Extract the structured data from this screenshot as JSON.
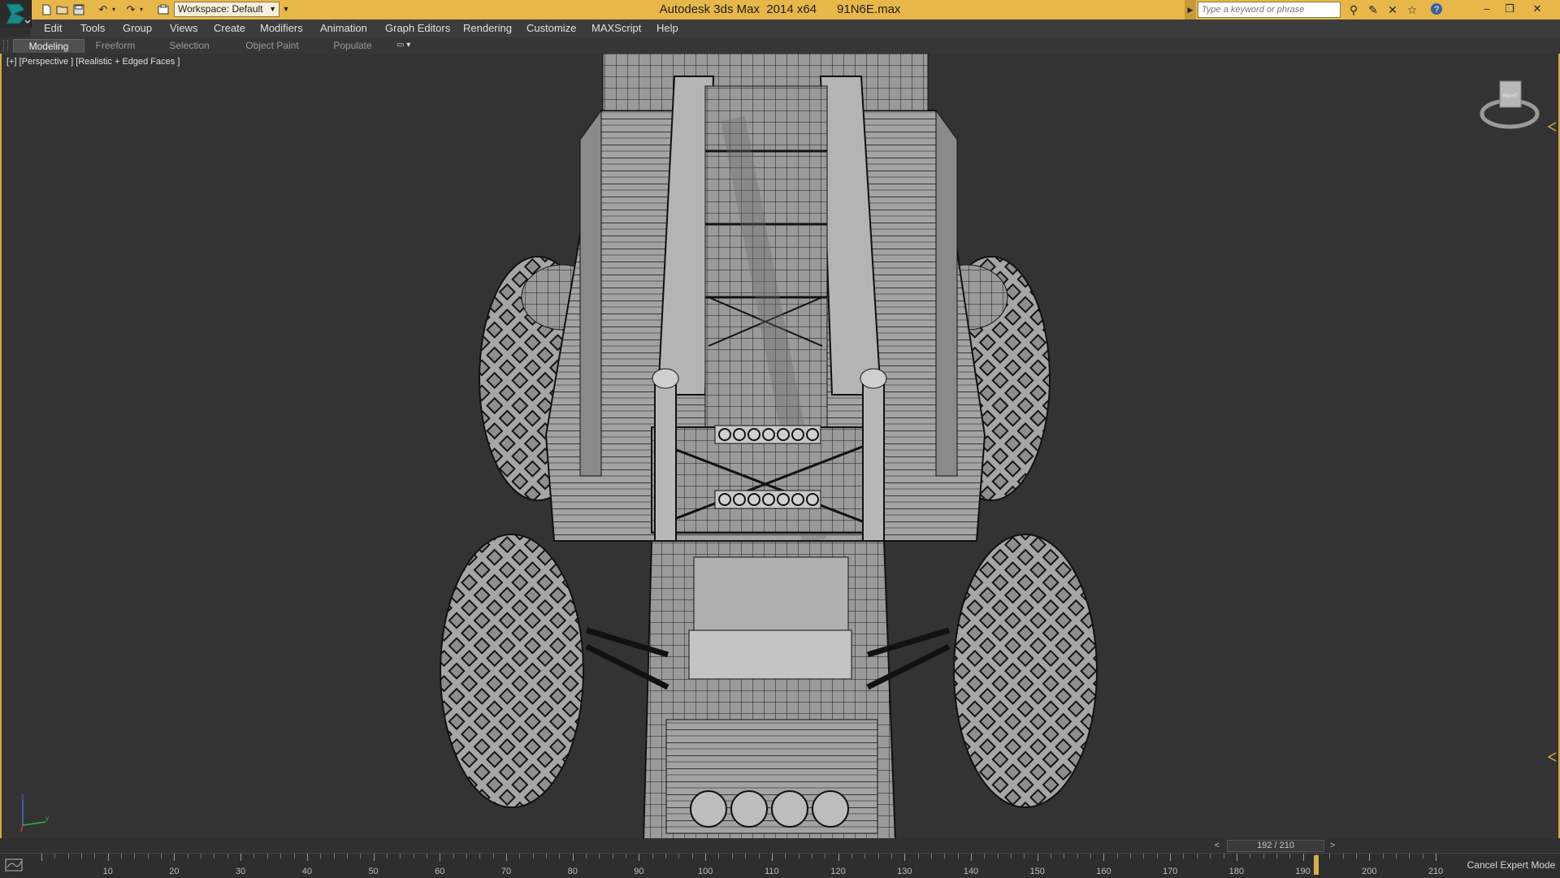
{
  "titlebar": {
    "workspace_label": "Workspace: Default",
    "title": "Autodesk 3ds Max  2014 x64      91N6E.max",
    "search_placeholder": "Type a keyword or phrase",
    "quick_access_icons": [
      "new-file-icon",
      "open-file-icon",
      "save-icon",
      "undo-icon",
      "undo-dropdown-icon",
      "redo-icon",
      "redo-dropdown-icon",
      "project-folder-icon"
    ],
    "toolbar_icons": [
      "infocenter-binoculars-icon",
      "communication-center-icon",
      "subscription-center-icon",
      "favorites-star-icon",
      "help-icon"
    ],
    "window_controls": [
      "minimize-icon",
      "restore-icon",
      "close-icon"
    ]
  },
  "menubar": {
    "items": [
      "Edit",
      "Tools",
      "Group",
      "Views",
      "Create",
      "Modifiers",
      "Animation",
      "Graph Editors",
      "Rendering",
      "Customize",
      "MAXScript",
      "Help"
    ]
  },
  "ribbon": {
    "tabs": [
      "Modeling",
      "Freeform",
      "Selection",
      "Object Paint",
      "Populate"
    ],
    "active_tab": "Modeling"
  },
  "viewport": {
    "label": "[+] [Perspective ] [Realistic + Edged Faces ]",
    "viewcube_face": "RIGHT",
    "axes": [
      "x",
      "y",
      "z"
    ],
    "colors": {
      "background": "#333333",
      "border": "#d9a93e",
      "mesh_fill": "#9c9c9c",
      "mesh_edge": "#141414"
    }
  },
  "timeline": {
    "current_frame": 192,
    "total_frames": 210,
    "frame_counter": "192 / 210",
    "prev_label": "<",
    "next_label": ">",
    "tick_labels": [
      "10",
      "20",
      "30",
      "40",
      "50",
      "60",
      "70",
      "80",
      "90",
      "100",
      "110",
      "120",
      "130",
      "140",
      "150",
      "160",
      "170",
      "180",
      "190",
      "200",
      "210"
    ],
    "cancel_expert_label": "Cancel Expert Mode"
  }
}
